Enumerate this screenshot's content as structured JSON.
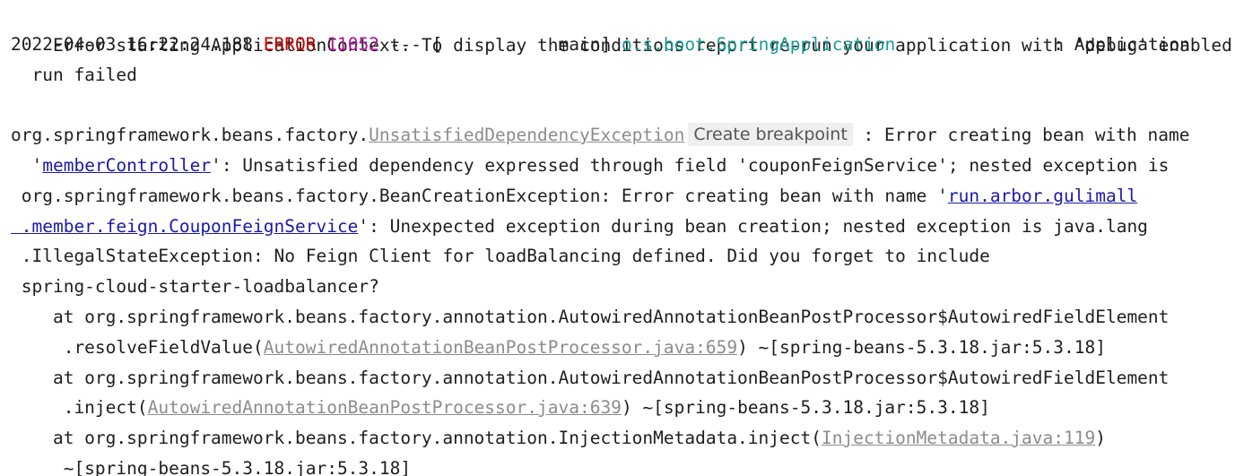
{
  "console": {
    "line1": "Error starting ApplicationContext. To display the conditions report re-run your application with 'debug' enabled.",
    "line2": {
      "timestamp": "2022-04-03 16:22:24.188 ",
      "level": "ERROR",
      "sp1": " ",
      "pid": "11052",
      "mid": " --- [           main] ",
      "logger": "o.s.boot.SpringApplication",
      "msg": "               : Application"
    },
    "line3": "  run failed",
    "line5": {
      "pkg": "org.springframework.beans.factory.",
      "exception": "UnsatisfiedDependencyException",
      "breakpoint_label": "Create breakpoint",
      "rest": " : Error creating bean with name"
    },
    "line6": {
      "pre": "  '",
      "link": "memberController",
      "post": "': Unsatisfied dependency expressed through field 'couponFeignService'; nested exception is"
    },
    "line7": {
      "pre": " org.springframework.beans.factory.BeanCreationException: Error creating bean with name '",
      "link": "run.arbor.gulimall"
    },
    "line8": {
      "link": " .member.feign.CouponFeignService",
      "post": "': Unexpected exception during bean creation; nested exception is java.lang"
    },
    "line9": " .IllegalStateException: No Feign Client for loadBalancing defined. Did you forget to include",
    "line10": " spring-cloud-starter-loadbalancer?",
    "line11": "    at org.springframework.beans.factory.annotation.AutowiredAnnotationBeanPostProcessor$AutowiredFieldElement",
    "line12": {
      "pre": "     .resolveFieldValue(",
      "link": "AutowiredAnnotationBeanPostProcessor.java:659",
      "post": ") ~[spring-beans-5.3.18.jar:5.3.18]"
    },
    "line13": "    at org.springframework.beans.factory.annotation.AutowiredAnnotationBeanPostProcessor$AutowiredFieldElement",
    "line14": {
      "pre": "     .inject(",
      "link": "AutowiredAnnotationBeanPostProcessor.java:639",
      "post": ") ~[spring-beans-5.3.18.jar:5.3.18]"
    },
    "line15": {
      "pre": "    at org.springframework.beans.factory.annotation.InjectionMetadata.inject(",
      "link": "InjectionMetadata.java:119",
      "post": ")"
    },
    "line16": "     ~[spring-beans-5.3.18.jar:5.3.18]"
  }
}
